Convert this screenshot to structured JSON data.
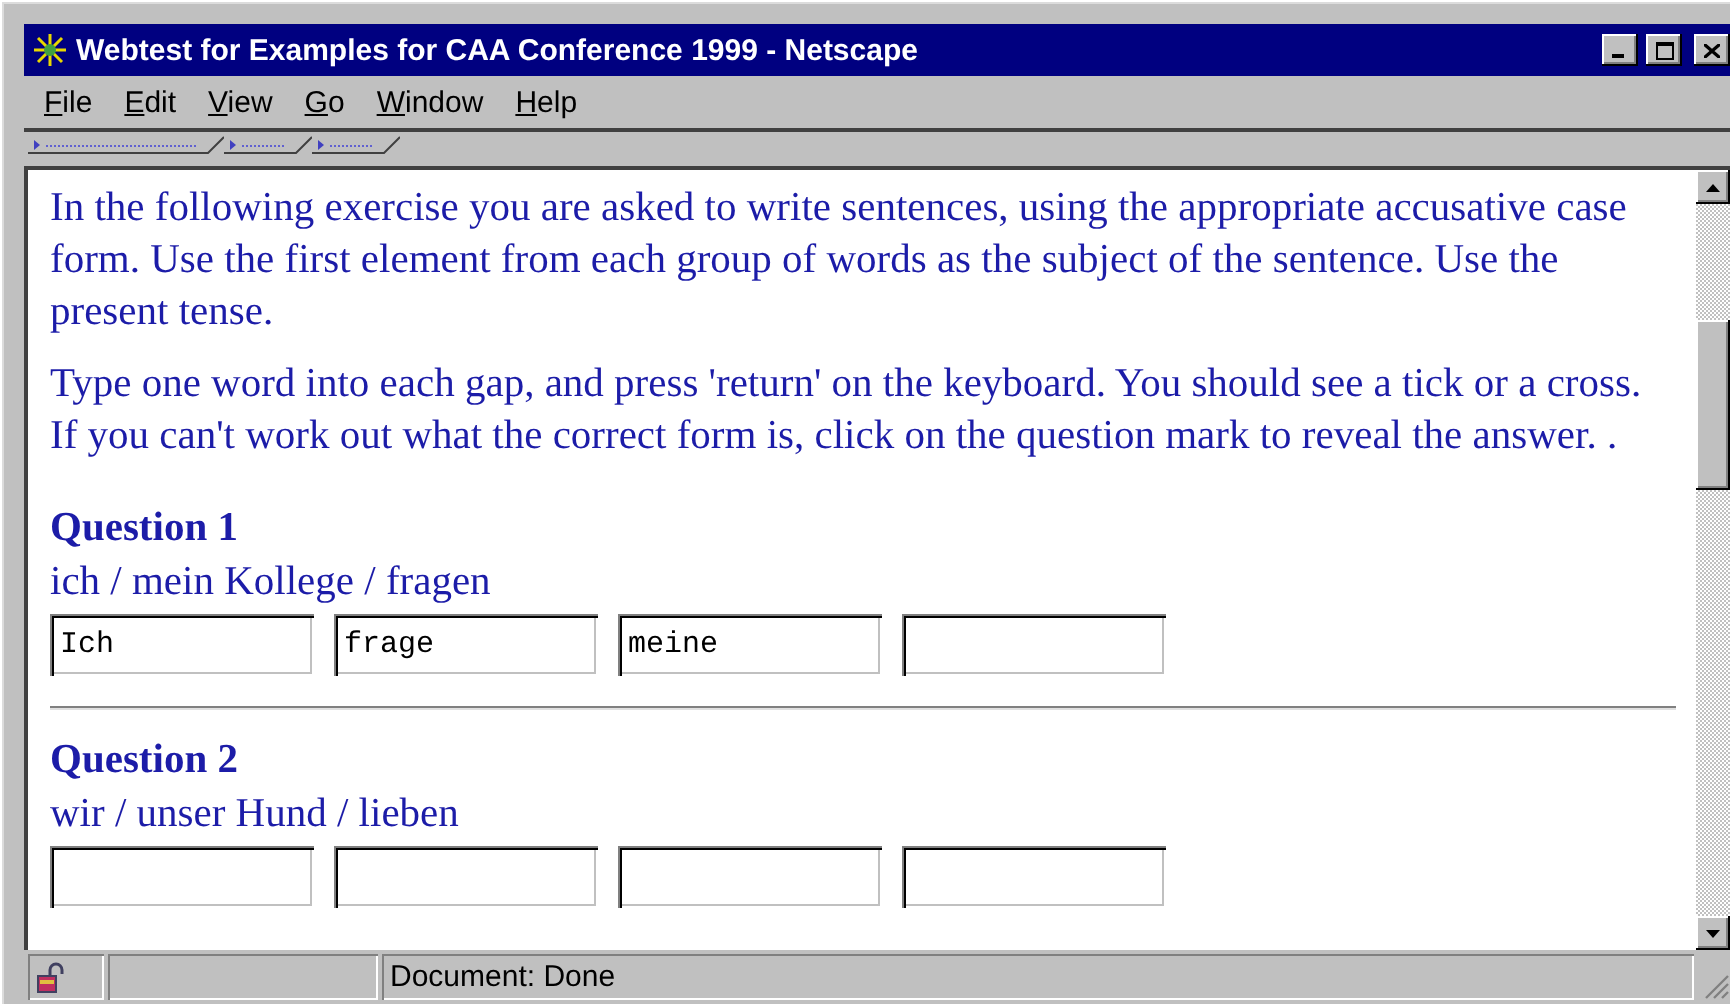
{
  "window": {
    "title": "Webtest for Examples for CAA Conference 1999 - Netscape"
  },
  "menu": [
    {
      "label": "File"
    },
    {
      "label": "Edit"
    },
    {
      "label": "View"
    },
    {
      "label": "Go"
    },
    {
      "label": "Window"
    },
    {
      "label": "Help"
    }
  ],
  "toolbar_tabs": [
    {
      "kind": "long"
    },
    {
      "kind": "short"
    },
    {
      "kind": "short"
    }
  ],
  "instructions": [
    "In the following exercise you are asked to write sentences, using the appropriate accusative case form. Use the first element from each group of words as the subject of the sentence. Use the present tense.",
    "Type one word into each gap, and press 'return' on the keyboard. You should see a tick or a cross. If you can't work out what the correct form is, click on the question mark to reveal the answer. ."
  ],
  "questions": [
    {
      "heading": "Question 1",
      "prompt": "ich / mein Kollege / fragen",
      "fields": [
        {
          "kind": "text",
          "value": "Ich"
        },
        {
          "kind": "text",
          "value": "frage"
        },
        {
          "kind": "text",
          "value": "meine"
        },
        {
          "kind": "text"
        }
      ]
    },
    {
      "heading": "Question 2",
      "prompt": "wir / unser Hund / lieben",
      "fields": [
        {
          "kind": "text"
        },
        {
          "kind": "text"
        },
        {
          "kind": "text"
        },
        {
          "kind": "text"
        }
      ]
    }
  ],
  "status_bar": {
    "text": "Document: Done"
  }
}
